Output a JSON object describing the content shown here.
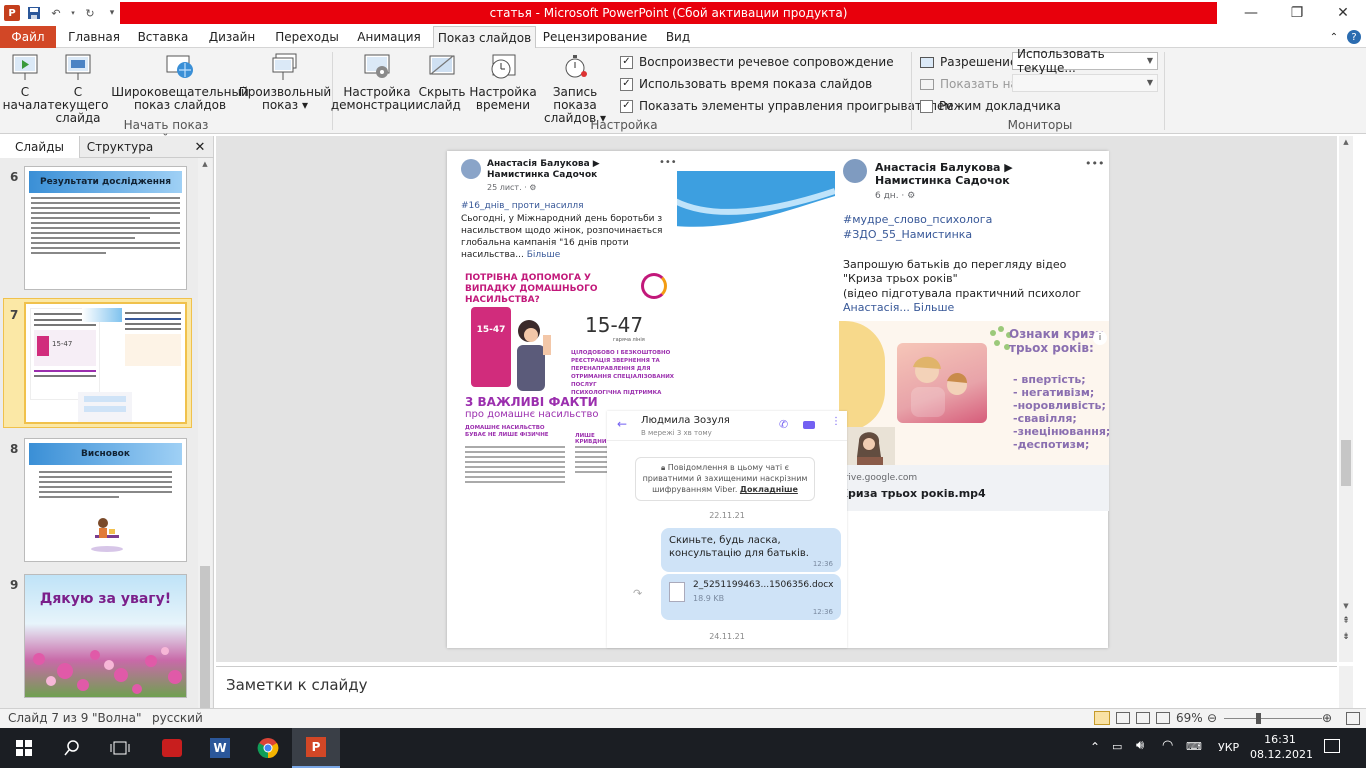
{
  "window": {
    "title": "статья  -  Microsoft PowerPoint (Сбой активации продукта)",
    "controls": {
      "minimize": "—",
      "restore": "❐",
      "close": "✕"
    }
  },
  "tabs": [
    "Файл",
    "Главная",
    "Вставка",
    "Дизайн",
    "Переходы",
    "Анимация",
    "Показ слайдов",
    "Рецензирование",
    "Вид"
  ],
  "active_tab": "Показ слайдов",
  "ribbon": {
    "from_start": [
      "С",
      "начала"
    ],
    "from_current": [
      "С текущего",
      "слайда"
    ],
    "broadcast": [
      "Широковещательный",
      "показ слайдов"
    ],
    "custom": [
      "Произвольный",
      "показ ▾"
    ],
    "group_start": "Начать показ слайдов",
    "setup": [
      "Настройка",
      "демонстрации"
    ],
    "hide": [
      "Скрыть",
      "слайд"
    ],
    "rehearse": [
      "Настройка",
      "времени"
    ],
    "record": [
      "Запись показа",
      "слайдов ▾"
    ],
    "group_setup": "Настройка",
    "checks": [
      {
        "label": "Воспроизвести речевое сопровождение",
        "checked": true
      },
      {
        "label": "Использовать время показа слайдов",
        "checked": true
      },
      {
        "label": "Показать элементы управления проигрывателем",
        "checked": true
      }
    ],
    "resolution_label": "Разрешение:",
    "resolution_value": "Использовать текуще...",
    "show_on_label": "Показать на:",
    "show_on_value": "",
    "presenter_label": "Режим докладчика",
    "presenter_checked": false,
    "group_monitors": "Мониторы"
  },
  "panel": {
    "tab_slides": "Слайды",
    "tab_outline": "Структура",
    "close": "✕",
    "slides": [
      {
        "num": "6",
        "title": "Результати дослідження"
      },
      {
        "num": "7",
        "title": ""
      },
      {
        "num": "8",
        "title": "Висновок"
      },
      {
        "num": "9",
        "title": "Дякую за увагу!"
      }
    ]
  },
  "slide": {
    "post1": {
      "author": "Анастасія Балукова ▶ Намистинка Садочок",
      "time": "25 лист. · ⚙",
      "hashtag": "#16_днів_ проти_насилля",
      "text": "Сьогодні, у Міжнародний день боротьби з насильством щодо жінок, розпочинається глобальна кампанія \"16 днів проти насильства...",
      "more": "Більше",
      "poster_title": "ПОТРІБНА ДОПОМОГА У ВИПАДКУ ДОМАШНЬОГО НАСИЛЬСТВА?",
      "hotline": "15-47",
      "hotline_note": "гаряча лінія",
      "bullets": [
        "ЦІЛОДОБОВО І БЕЗКОШТОВНО",
        "РЕЄСТРАЦІЯ ЗВЕРНЕННЯ ТА ПЕРЕНАПРАВЛЕННЯ ДЛЯ ОТРИМАННЯ СПЕЦІАЛІЗОВАНИХ ПОСЛУГ",
        "ПСИХОЛОГІЧНА ПІДТРИМКА"
      ],
      "facts_title": "3 ВАЖЛИВІ ФАКТИ",
      "facts_sub": "про домашнє насильство",
      "col1_title": "ДОМАШНЄ НАСИЛЬСТВО БУВАЄ НЕ ЛИШЕ ФІЗИЧНЕ",
      "col2_title": "ЛИШЕ КРИВДНИ"
    },
    "post2": {
      "author": "Анастасія Балукова ▶ Намистинка Садочок",
      "time": "6 дн. · ⚙",
      "hashtags": [
        "#мудре_слово_психолога",
        "#ЗДО_55_Намистинка"
      ],
      "text1": "Запрошую батьків до перегляду відео \"Криза трьох років\"",
      "text2": "(відео підготувала практичний психолог",
      "text3": "Анастасія...",
      "more": "Більше",
      "video_title": "Ознаки кризи трьох років:",
      "signs": [
        "- впертість;",
        "- негативізм;",
        "-норовливість;",
        "-свавілля;",
        "-знецінювання;",
        "-деспотизм;"
      ],
      "domain": "drive.google.com",
      "file": "Криза трьох років.mp4"
    },
    "viber": {
      "name": "Людмила Зозуля",
      "status": "В мережі 3 хв тому",
      "notice": "Повідомлення в цьому чаті є приватними й захищеними наскрізним шифруванням Viber.",
      "notice_link": "Докладніше",
      "date1": "22.11.21",
      "msg": "Скиньте, будь ласка, консультацію для батьків.",
      "msg_time": "12:36",
      "file": "2_5251199463...1506356.docx",
      "size": "18.9 KB",
      "file_time": "12:36",
      "date2": "24.11.21"
    }
  },
  "notes_placeholder": "Заметки к слайду",
  "status": {
    "slide": "Слайд 7 из 9",
    "theme": "\"Волна\"",
    "lang": "русский",
    "zoom": "69%",
    "zoom_fraction": 0.69
  },
  "taskbar": {
    "lang": "УКР",
    "time": "16:31",
    "date": "08.12.2021"
  }
}
